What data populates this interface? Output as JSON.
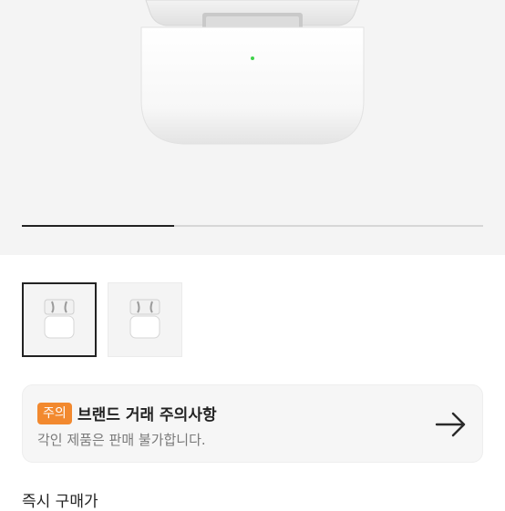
{
  "gallery": {
    "progress_fraction": 0.33,
    "thumbnails": [
      {
        "icon": "airpods-pro-case-icon",
        "selected": true
      },
      {
        "icon": "airpods-pro-case-icon",
        "selected": false
      }
    ]
  },
  "notice": {
    "badge": "주의",
    "badge_color": "#f2892f",
    "title": "브랜드 거래 주의사항",
    "subtitle": "각인 제품은 판매 불가합니다.",
    "arrow_icon": "arrow-right-icon"
  },
  "price_section": {
    "title": "즉시 구매가"
  },
  "colors": {
    "indicator_light": "#3fd24a"
  }
}
